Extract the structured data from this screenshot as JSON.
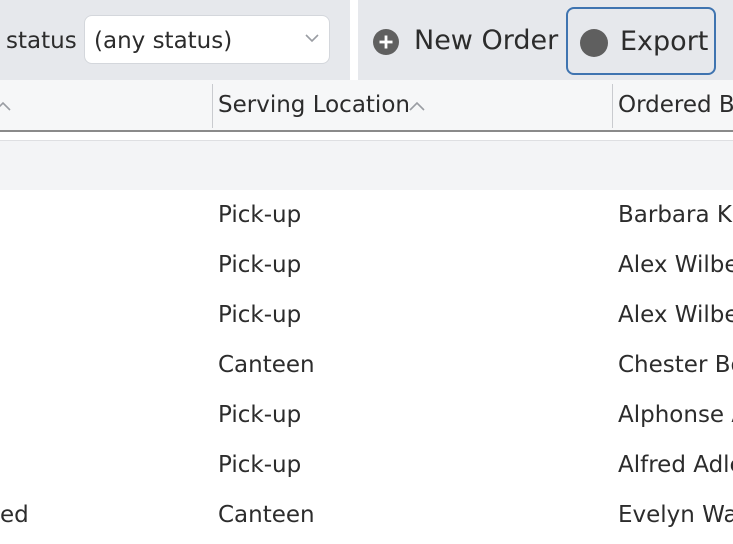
{
  "toolbar": {
    "status_label": "status",
    "status_select_value": "(any status)",
    "new_order_label": "New Order",
    "export_label": "Export"
  },
  "table": {
    "columns": [
      {
        "label": ""
      },
      {
        "label": "Serving Location"
      },
      {
        "label": "Ordered B"
      }
    ],
    "rows": [
      {
        "status": "",
        "location": "Pick-up",
        "ordered_by": "Barbara Kr"
      },
      {
        "status": "",
        "location": "Pick-up",
        "ordered_by": "Alex Wilbe"
      },
      {
        "status": "",
        "location": "Pick-up",
        "ordered_by": "Alex Wilbe"
      },
      {
        "status": "",
        "location": "Canteen",
        "ordered_by": "Chester Bo"
      },
      {
        "status": "",
        "location": "Pick-up",
        "ordered_by": "Alphonse A"
      },
      {
        "status": "",
        "location": "Pick-up",
        "ordered_by": "Alfred Adle"
      },
      {
        "status": "ed",
        "location": "Canteen",
        "ordered_by": "Evelyn Wa"
      }
    ]
  }
}
